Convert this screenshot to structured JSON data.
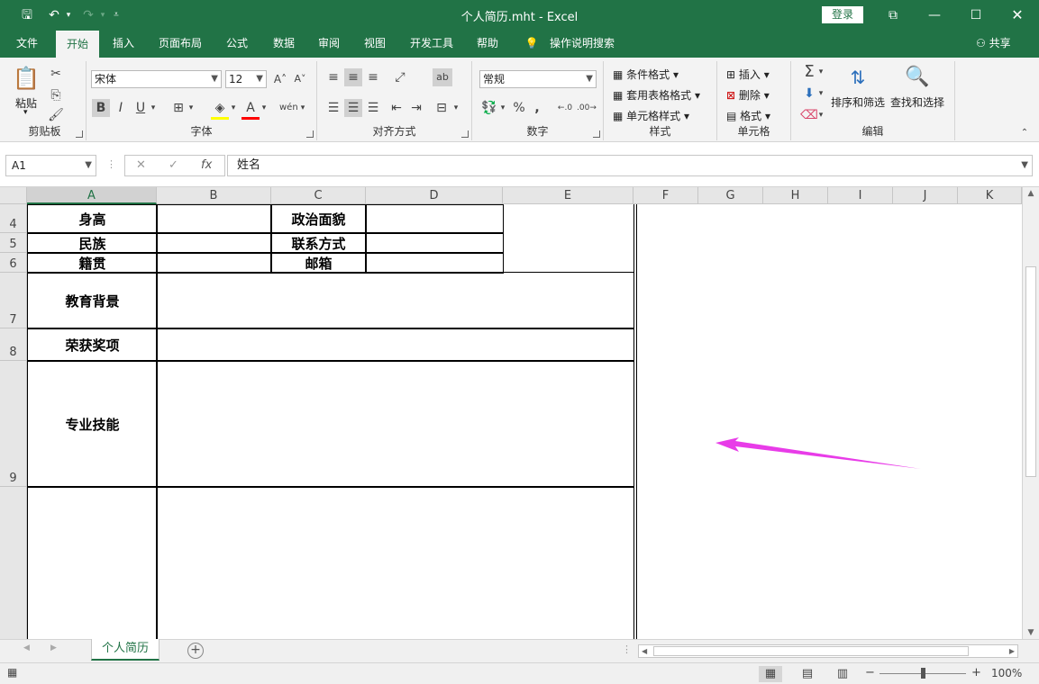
{
  "window": {
    "title": "个人简历.mht  -  Excel",
    "login_label": "登录"
  },
  "tabs": [
    {
      "label": "文件"
    },
    {
      "label": "开始"
    },
    {
      "label": "插入"
    },
    {
      "label": "页面布局"
    },
    {
      "label": "公式"
    },
    {
      "label": "数据"
    },
    {
      "label": "审阅"
    },
    {
      "label": "视图"
    },
    {
      "label": "开发工具"
    },
    {
      "label": "帮助"
    },
    {
      "label": "操作说明搜索"
    }
  ],
  "share_label": "共享",
  "ribbon": {
    "clipboard": {
      "label": "剪贴板",
      "paste": "粘贴"
    },
    "font": {
      "label": "字体",
      "family": "宋体",
      "size": "12"
    },
    "alignment": {
      "label": "对齐方式"
    },
    "number": {
      "label": "数字",
      "format": "常规"
    },
    "styles": {
      "label": "样式",
      "conditional": "条件格式",
      "table_format": "套用表格格式",
      "cell_styles": "单元格样式"
    },
    "cells": {
      "label": "单元格",
      "insert": "插入",
      "delete": "删除",
      "format": "格式"
    },
    "editing": {
      "label": "编辑",
      "sort_filter": "排序和筛选",
      "find_select": "查找和选择"
    }
  },
  "formula_bar": {
    "name_box": "A1",
    "formula": "姓名"
  },
  "columns": [
    "A",
    "B",
    "C",
    "D",
    "E",
    "F",
    "G",
    "H",
    "I",
    "J",
    "K"
  ],
  "rows": [
    "4",
    "5",
    "6",
    "7",
    "8",
    "9"
  ],
  "cells": {
    "a4": "身高",
    "c4": "政治面貌",
    "a5": "民族",
    "c5": "联系方式",
    "a6": "籍贯",
    "c6": "邮箱",
    "a7": "教育背景",
    "a8": "荣获奖项",
    "a9": "专业技能"
  },
  "sheet_tab": "个人简历",
  "zoom": "100%",
  "annotation_color": "#e83ce8",
  "accent_color": "#217346"
}
